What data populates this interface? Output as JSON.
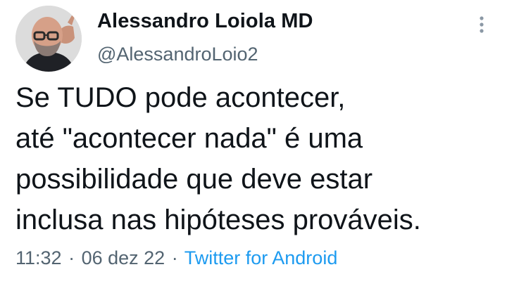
{
  "author": {
    "display_name": "Alessandro Loiola MD",
    "handle": "@AlessandroLoio2",
    "avatar_icon": "profile-photo"
  },
  "menu": {
    "icon": "more-vertical-icon"
  },
  "tweet": {
    "lines": [
      "Se TUDO pode acontecer,",
      "até \"acontecer nada\" é uma",
      "possibilidade que deve estar",
      "inclusa nas hipóteses prováveis."
    ]
  },
  "meta": {
    "time": "11:32",
    "separator": "·",
    "date": "06 dez 22",
    "source": "Twitter for Android"
  },
  "colors": {
    "text": "#0f1419",
    "secondary": "#536471",
    "link": "#1d9bf0"
  }
}
